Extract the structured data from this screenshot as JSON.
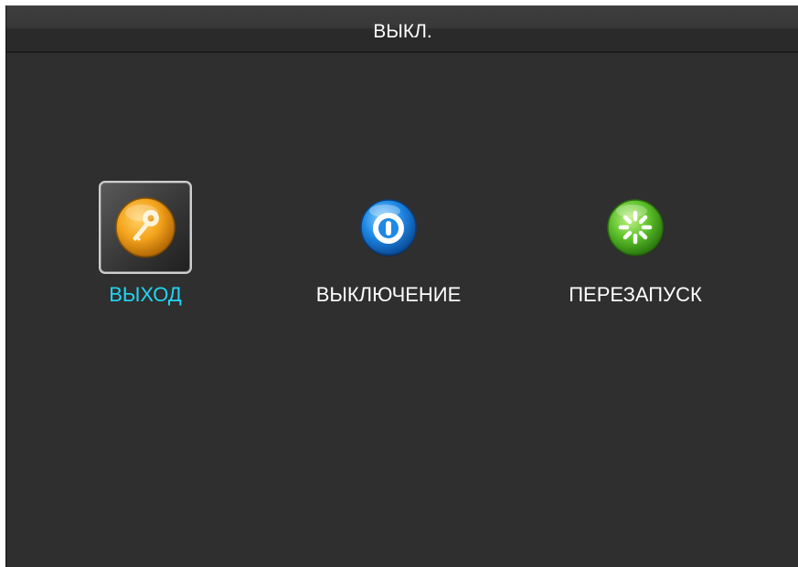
{
  "window": {
    "title": "ВЫКЛ."
  },
  "menu": {
    "items": [
      {
        "label": "ВЫХОД",
        "icon": "key-icon",
        "selected": true
      },
      {
        "label": "ВЫКЛЮЧЕНИЕ",
        "icon": "power-icon",
        "selected": false
      },
      {
        "label": "ПЕРЕЗАПУСК",
        "icon": "restart-icon",
        "selected": false
      }
    ]
  },
  "colors": {
    "background": "#2f2f2f",
    "selected_label": "#21d6f4",
    "label": "#ffffff",
    "key_icon": "#f0a21c",
    "power_icon": "#1e88e5",
    "restart_icon": "#5cc02a"
  }
}
